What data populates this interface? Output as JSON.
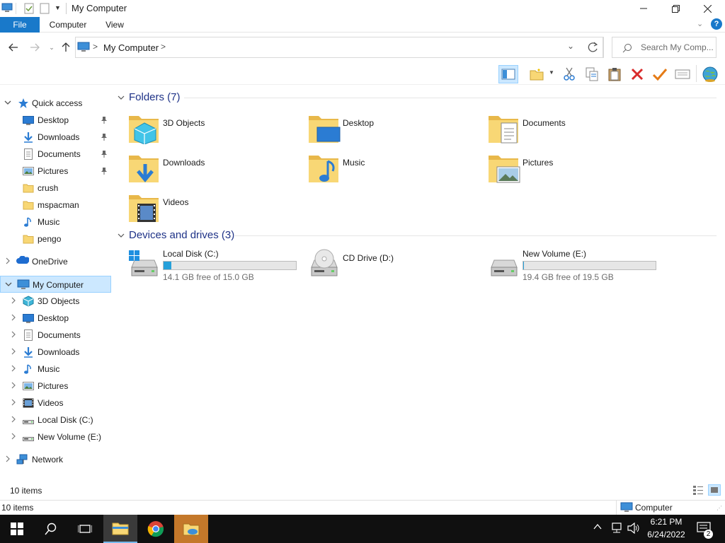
{
  "window": {
    "title": "My Computer"
  },
  "ribbon": {
    "tabs": [
      "File",
      "Computer",
      "View"
    ]
  },
  "address": {
    "path": "My Computer",
    "separator": ">"
  },
  "search": {
    "placeholder": "Search My Comp..."
  },
  "nav": {
    "quick_access": "Quick access",
    "quick_items": [
      {
        "label": "Desktop",
        "icon": "desktop-icon",
        "pinned": true
      },
      {
        "label": "Downloads",
        "icon": "downloads-icon",
        "pinned": true
      },
      {
        "label": "Documents",
        "icon": "documents-icon",
        "pinned": true
      },
      {
        "label": "Pictures",
        "icon": "pictures-icon",
        "pinned": true
      },
      {
        "label": "crush",
        "icon": "folder-icon",
        "pinned": false
      },
      {
        "label": "mspacman",
        "icon": "folder-icon",
        "pinned": false
      },
      {
        "label": "Music",
        "icon": "music-icon",
        "pinned": false
      },
      {
        "label": "pengo",
        "icon": "folder-icon",
        "pinned": false
      }
    ],
    "onedrive": "OneDrive",
    "my_computer": "My Computer",
    "computer_items": [
      {
        "label": "3D Objects",
        "icon": "3d-objects-icon"
      },
      {
        "label": "Desktop",
        "icon": "desktop-icon"
      },
      {
        "label": "Documents",
        "icon": "documents-icon"
      },
      {
        "label": "Downloads",
        "icon": "downloads-icon"
      },
      {
        "label": "Music",
        "icon": "music-icon"
      },
      {
        "label": "Pictures",
        "icon": "pictures-icon"
      },
      {
        "label": "Videos",
        "icon": "videos-icon"
      },
      {
        "label": "Local Disk (C:)",
        "icon": "drive-icon"
      },
      {
        "label": "New Volume (E:)",
        "icon": "drive-icon"
      }
    ],
    "network": "Network"
  },
  "content": {
    "folders_header": "Folders (7)",
    "folders": [
      {
        "label": "3D Objects",
        "icon": "3d-objects-icon"
      },
      {
        "label": "Desktop",
        "icon": "desktop-icon"
      },
      {
        "label": "Documents",
        "icon": "documents-icon"
      },
      {
        "label": "Downloads",
        "icon": "downloads-icon"
      },
      {
        "label": "Music",
        "icon": "music-icon"
      },
      {
        "label": "Pictures",
        "icon": "pictures-icon"
      },
      {
        "label": "Videos",
        "icon": "videos-icon"
      }
    ],
    "drives_header": "Devices and drives (3)",
    "drives": [
      {
        "label": "Local Disk (C:)",
        "free": "14.1 GB free of 15.0 GB",
        "used_fraction": 0.06,
        "has_bar": true,
        "icon": "windows-drive-icon"
      },
      {
        "label": "CD Drive (D:)",
        "free": "",
        "used_fraction": 0,
        "has_bar": false,
        "icon": "cd-drive-icon"
      },
      {
        "label": "New Volume (E:)",
        "free": "19.4 GB free of 19.5 GB",
        "used_fraction": 0.005,
        "has_bar": true,
        "icon": "drive-icon"
      }
    ]
  },
  "status": {
    "items_count": "10 items",
    "bottom_count": "10 items",
    "bottom_location": "Computer"
  },
  "taskbar": {
    "time": "6:21 PM",
    "date": "6/24/2022",
    "notification_count": "2"
  },
  "colors": {
    "accent": "#1979ca",
    "selection": "#cce8ff",
    "header_text": "#1e3287",
    "folder": "#f8d775",
    "drive_bar": "#26a0da"
  }
}
